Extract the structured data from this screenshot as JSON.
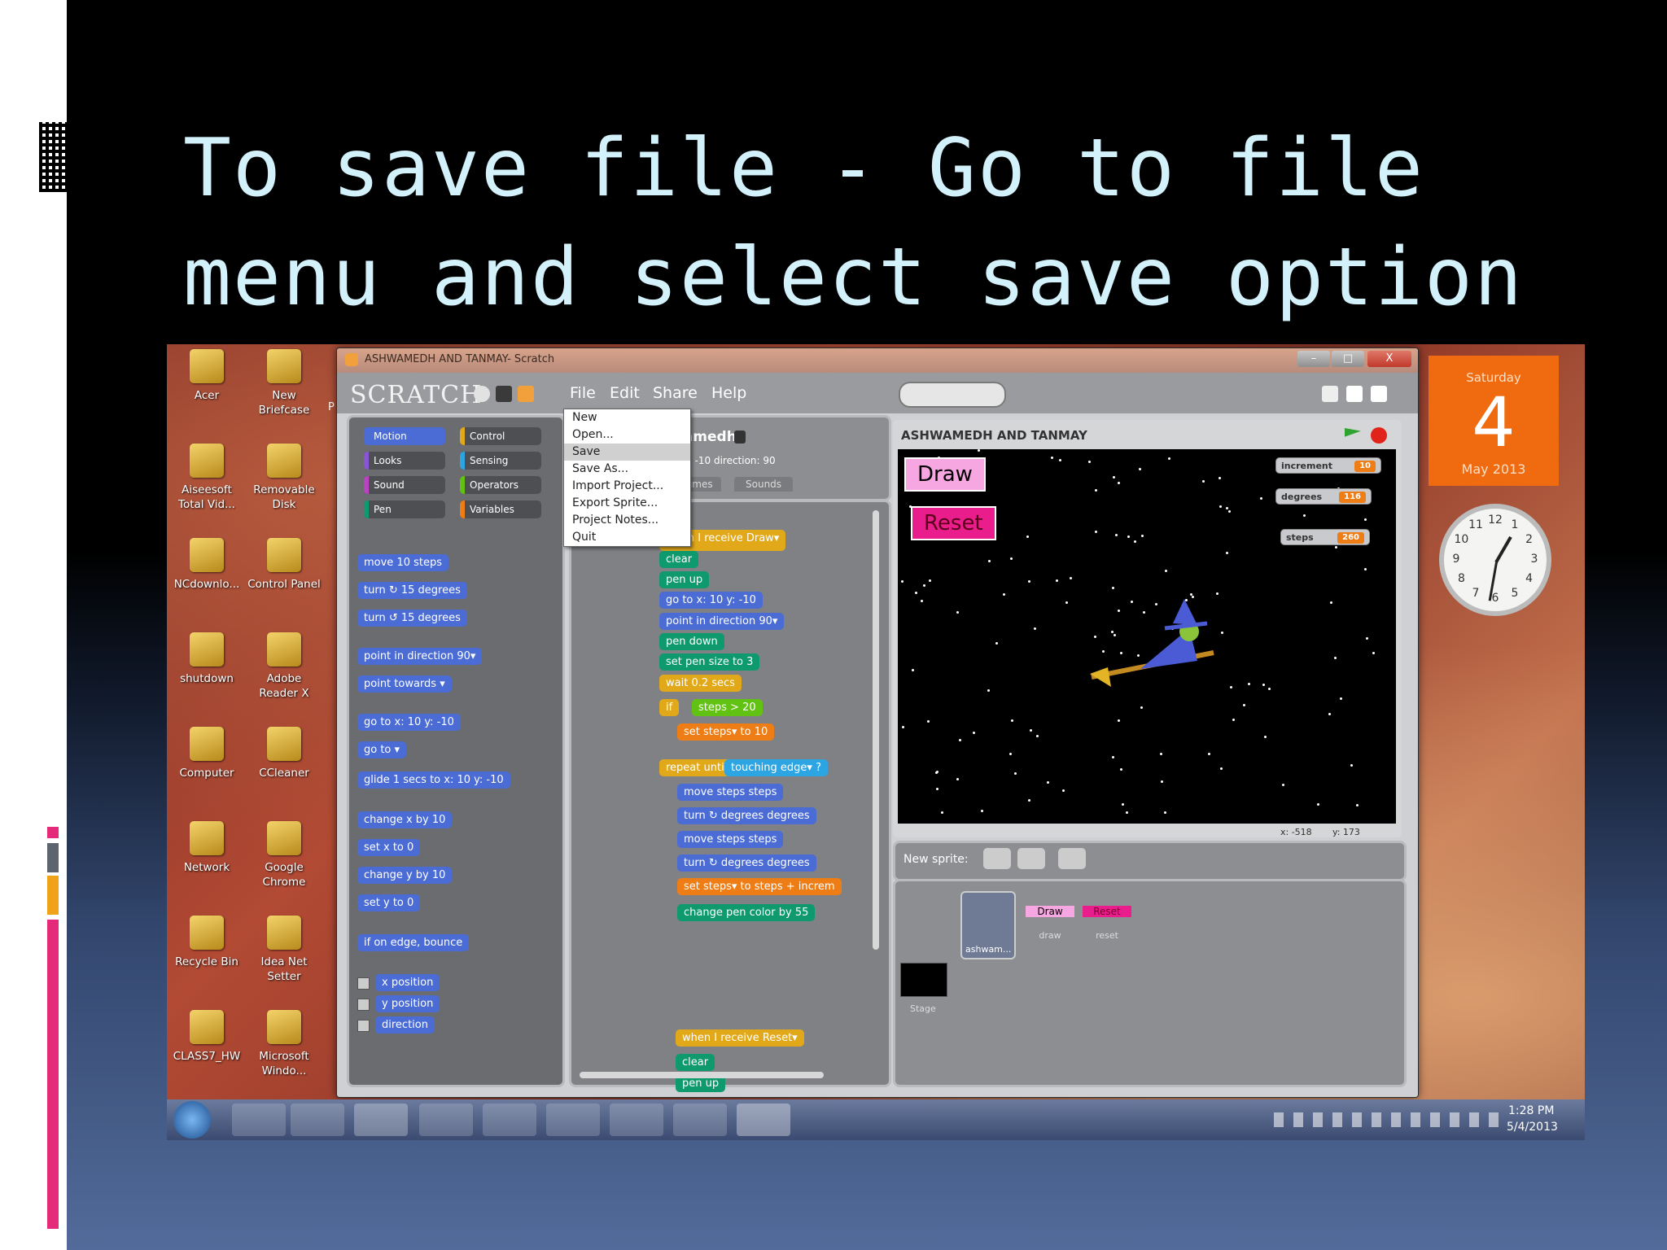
{
  "slide": {
    "title_line1": "To save file - Go to file",
    "title_line2": "menu and select save option"
  },
  "desktop": {
    "icons": [
      {
        "label": "Acer",
        "icon": "folder-icon"
      },
      {
        "label": "New Briefcase",
        "icon": "briefcase-icon"
      },
      {
        "label": "Aiseesoft Total Vid...",
        "icon": "video-converter-icon"
      },
      {
        "label": "Removable Disk",
        "icon": "folder-icon"
      },
      {
        "label": "NCdownlo...",
        "icon": "download-icon"
      },
      {
        "label": "Control Panel",
        "icon": "control-panel-icon"
      },
      {
        "label": "shutdown",
        "icon": "shortcut-icon"
      },
      {
        "label": "Adobe Reader X",
        "icon": "pdf-icon"
      },
      {
        "label": "Computer",
        "icon": "computer-icon"
      },
      {
        "label": "CCleaner",
        "icon": "ccleaner-icon"
      },
      {
        "label": "Network",
        "icon": "network-icon"
      },
      {
        "label": "Google Chrome",
        "icon": "chrome-icon"
      },
      {
        "label": "Recycle Bin",
        "icon": "recycle-bin-icon"
      },
      {
        "label": "Idea Net Setter",
        "icon": "modem-icon"
      },
      {
        "label": "CLASS7_HW",
        "icon": "folder-icon"
      },
      {
        "label": "Microsoft Windo...",
        "icon": "shortcut-icon"
      }
    ],
    "partial_label": "P"
  },
  "window": {
    "title": "ASHWAMEDH AND TANMAY- Scratch",
    "logo": "SCRATCH",
    "menus": [
      "File",
      "Edit",
      "Share",
      "Help"
    ],
    "controls": [
      "–",
      "□",
      "X"
    ]
  },
  "file_menu": {
    "items": [
      "New",
      "Open...",
      "Save",
      "Save As...",
      "Import Project...",
      "Export Sprite...",
      "Project Notes...",
      "Quit"
    ],
    "selected": "Save"
  },
  "palette": {
    "categories": [
      {
        "label": "Motion",
        "color": "#4a6cd4"
      },
      {
        "label": "Control",
        "color": "#e1a91a"
      },
      {
        "label": "Looks",
        "color": "#8a55d7"
      },
      {
        "label": "Sensing",
        "color": "#2ca5e2"
      },
      {
        "label": "Sound",
        "color": "#bb42c3"
      },
      {
        "label": "Operators",
        "color": "#62c213"
      },
      {
        "label": "Pen",
        "color": "#0e9a6c"
      },
      {
        "label": "Variables",
        "color": "#ee7d16"
      }
    ],
    "blocks": [
      "move 10 steps",
      "turn ↻ 15 degrees",
      "turn ↺ 15 degrees",
      "point in direction 90▾",
      "point towards ▾",
      "go to x: 10 y: -10",
      "go to ▾",
      "glide 1 secs to x: 10 y: -10",
      "change x by 10",
      "set x to 0",
      "change y by 10",
      "set y to 0",
      "if on edge, bounce",
      "x position",
      "y position",
      "direction"
    ]
  },
  "sprite_info": {
    "name": "hwamedh",
    "coords": "0   y: -10   direction: 90",
    "tabs": [
      "tumes",
      "Sounds"
    ]
  },
  "scripts": {
    "script1": [
      "when I receive Draw▾",
      "clear",
      "pen up",
      "go to x: 10 y: -10",
      "point in direction 90▾",
      "pen down",
      "set pen size to 3",
      "wait 0.2 secs",
      "if",
      "steps > 20",
      "set steps▾ to 10",
      "repeat until",
      "touching edge▾ ?",
      "move steps steps",
      "turn ↻ degrees degrees",
      "move steps steps",
      "turn ↻ degrees degrees",
      "set steps▾ to steps + increm",
      "change pen color by 55"
    ],
    "script2": [
      "when I receive Reset▾",
      "clear",
      "pen up"
    ]
  },
  "stage": {
    "title": "ASHWAMEDH AND TANMAY",
    "draw_button": "Draw",
    "reset_button": "Reset",
    "monitors": [
      {
        "label": "increment",
        "value": "10"
      },
      {
        "label": "degrees",
        "value": "116"
      },
      {
        "label": "steps",
        "value": "260"
      }
    ],
    "mouse_x": "x: -518",
    "mouse_y": "y: 173"
  },
  "sprites": {
    "new_sprite_label": "New sprite:",
    "list": [
      {
        "name": "ashwam..."
      },
      {
        "name": "draw",
        "thumb": "Draw"
      },
      {
        "name": "reset",
        "thumb": "Reset"
      }
    ],
    "stage_label": "Stage"
  },
  "gadgets": {
    "day": "Saturday",
    "date": "4",
    "month_year": "May 2013",
    "clock_numbers": [
      "12",
      "1",
      "2",
      "3",
      "4",
      "5",
      "6",
      "7",
      "8",
      "9",
      "10",
      "11"
    ]
  },
  "taskbar": {
    "time": "1:28 PM",
    "date": "5/4/2013"
  },
  "colors": {
    "title_text": "#d3f1fb",
    "accent_pink": "#e52a7a",
    "accent_orange": "#f0a21a",
    "accent_gray": "#5e6370",
    "stage_button_pink": "#f06bc4"
  }
}
